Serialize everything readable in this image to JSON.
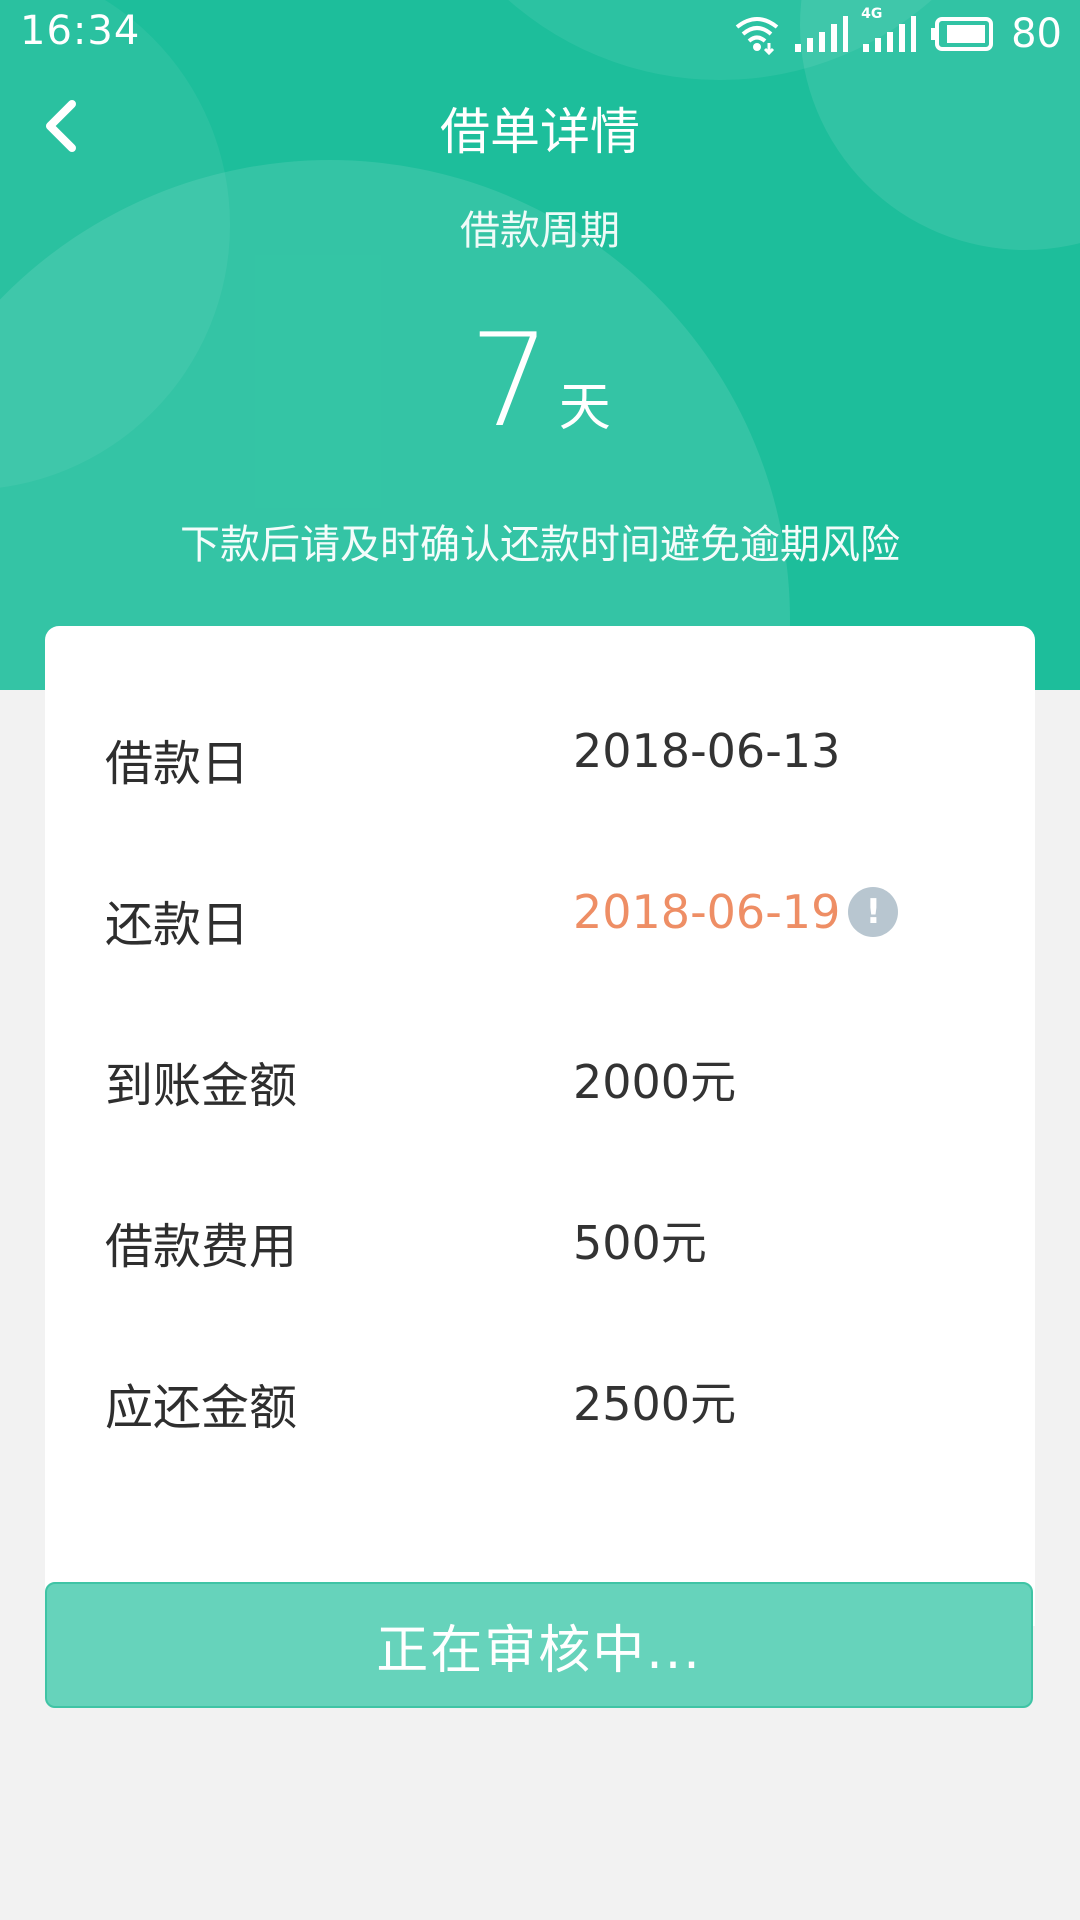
{
  "status_bar": {
    "time": "16:34",
    "network_label": "4G",
    "battery": "80"
  },
  "header": {
    "title": "借单详情",
    "period_label": "借款周期",
    "period_value": "7",
    "period_unit": "天",
    "notice": "下款后请及时确认还款时间避免逾期风险"
  },
  "details": {
    "rows": [
      {
        "label": "借款日",
        "value": "2018-06-13"
      },
      {
        "label": "还款日",
        "value": "2018-06-19",
        "info": "!"
      },
      {
        "label": "到账金额",
        "value": "2000元"
      },
      {
        "label": "借款费用",
        "value": "500元"
      },
      {
        "label": "应还金额",
        "value": "2500元"
      }
    ]
  },
  "action": {
    "status_label": "正在审核中..."
  },
  "colors": {
    "brand": "#1dbe9b",
    "highlight": "#ee8e65",
    "button": "#66d3bb",
    "background": "#f2f2f2"
  },
  "icons": {
    "back": "chevron-left-icon",
    "wifi": "wifi-icon",
    "signal": "signal-icon",
    "battery": "battery-icon",
    "info": "info-icon"
  }
}
